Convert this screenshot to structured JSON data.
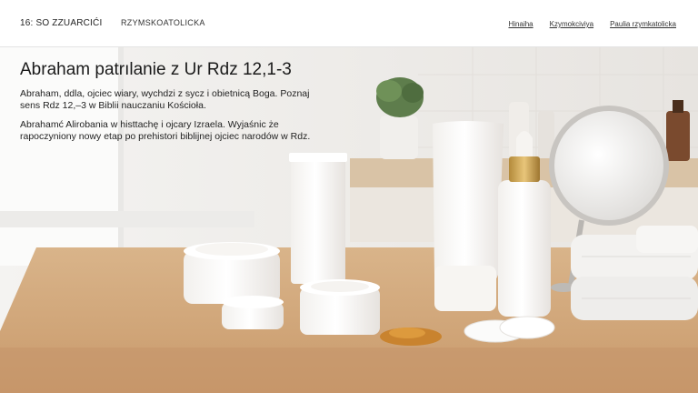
{
  "header": {
    "left_text": "16: SO ZZUARCIĆI",
    "brand": "RZYMSKOATOLICKA",
    "nav": [
      "Hinaiha",
      "Kzymokciviya",
      "Paulia rzymkatolicka"
    ]
  },
  "hero": {
    "title": "Abraham patrılanie z Ur Rdz 12,1-3",
    "paragraph1": "Abraham, ddla, ojciec wiary, wychdzi z sycz i obietnicą Boga. Poznaj sens Rdz 12,–3 w Biblii nauczaniu Kościoła.",
    "paragraph2": "Abrahamć Alirobania w histtachę i ojcary Izraela. Wyjaśnic że rapoczyniony nowy etap po prehistori biblijnej ojciec narodów w Rdz."
  }
}
